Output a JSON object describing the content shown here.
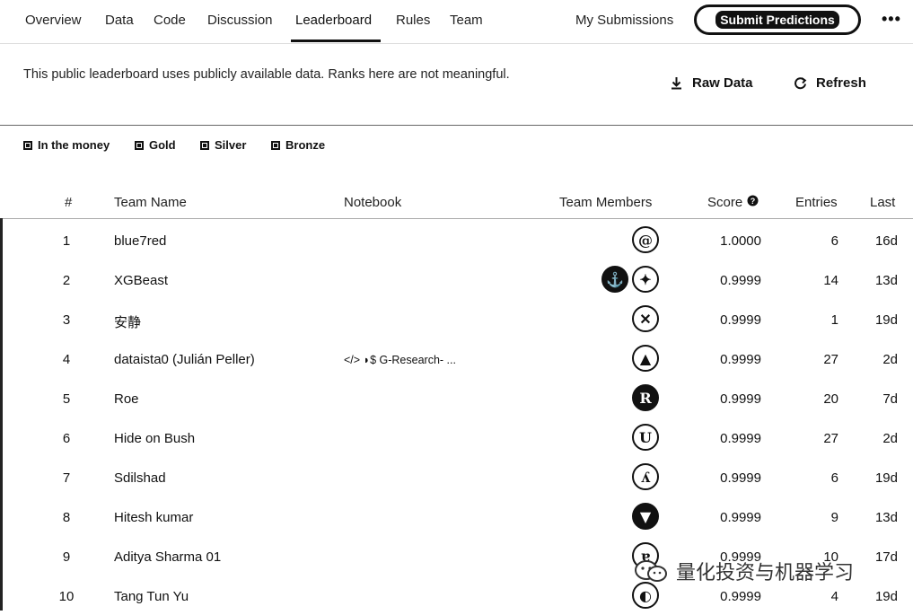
{
  "nav": {
    "tabs": [
      {
        "label": "Overview"
      },
      {
        "label": "Data"
      },
      {
        "label": "Code"
      },
      {
        "label": "Discussion"
      },
      {
        "label": "Leaderboard"
      },
      {
        "label": "Rules"
      },
      {
        "label": "Team"
      }
    ],
    "active_tab": "Leaderboard",
    "my_submissions": "My Submissions",
    "submit": "Submit Predictions",
    "more_icon": "more-horizontal-icon"
  },
  "notice": "This public leaderboard uses publicly available data. Ranks here are not meaningful.",
  "actions": {
    "raw_data": "Raw Data",
    "refresh": "Refresh"
  },
  "legend": [
    "In the money",
    "Gold",
    "Silver",
    "Bronze"
  ],
  "table": {
    "headers": {
      "rank": "#",
      "team": "Team Name",
      "notebook": "Notebook",
      "members": "Team Members",
      "score": "Score",
      "entries": "Entries",
      "last": "Last"
    },
    "rows": [
      {
        "rank": "1",
        "team": "blue7red",
        "notebook": "",
        "avatars": [
          "@"
        ],
        "score": "1.0000",
        "entries": "6",
        "last": "16d"
      },
      {
        "rank": "2",
        "team": "XGBeast",
        "notebook": "",
        "avatars": [
          "⚓",
          "✦"
        ],
        "score": "0.9999",
        "entries": "14",
        "last": "13d"
      },
      {
        "rank": "3",
        "team": "安静",
        "notebook": "",
        "avatars": [
          "✕"
        ],
        "score": "0.9999",
        "entries": "1",
        "last": "19d"
      },
      {
        "rank": "4",
        "team": "dataista0 (Julián Peller)",
        "notebook": "</> ◗$ G-Research- ...",
        "avatars": [
          "▲"
        ],
        "score": "0.9999",
        "entries": "27",
        "last": "2d"
      },
      {
        "rank": "5",
        "team": "Roe",
        "notebook": "",
        "avatars": [
          "R"
        ],
        "score": "0.9999",
        "entries": "20",
        "last": "7d"
      },
      {
        "rank": "6",
        "team": "Hide on Bush",
        "notebook": "",
        "avatars": [
          "U"
        ],
        "score": "0.9999",
        "entries": "27",
        "last": "2d"
      },
      {
        "rank": "7",
        "team": "Sdilshad",
        "notebook": "",
        "avatars": [
          "ʎ"
        ],
        "score": "0.9999",
        "entries": "6",
        "last": "19d"
      },
      {
        "rank": "8",
        "team": "Hitesh kumar",
        "notebook": "",
        "avatars": [
          "▼"
        ],
        "score": "0.9999",
        "entries": "9",
        "last": "13d"
      },
      {
        "rank": "9",
        "team": "Aditya Sharma 01",
        "notebook": "",
        "avatars": [
          "ɐ"
        ],
        "score": "0.9999",
        "entries": "10",
        "last": "17d"
      },
      {
        "rank": "10",
        "team": "Tang Tun Yu",
        "notebook": "",
        "avatars": [
          "◐"
        ],
        "score": "0.9999",
        "entries": "4",
        "last": "19d"
      }
    ]
  },
  "watermark": "量化投资与机器学习"
}
